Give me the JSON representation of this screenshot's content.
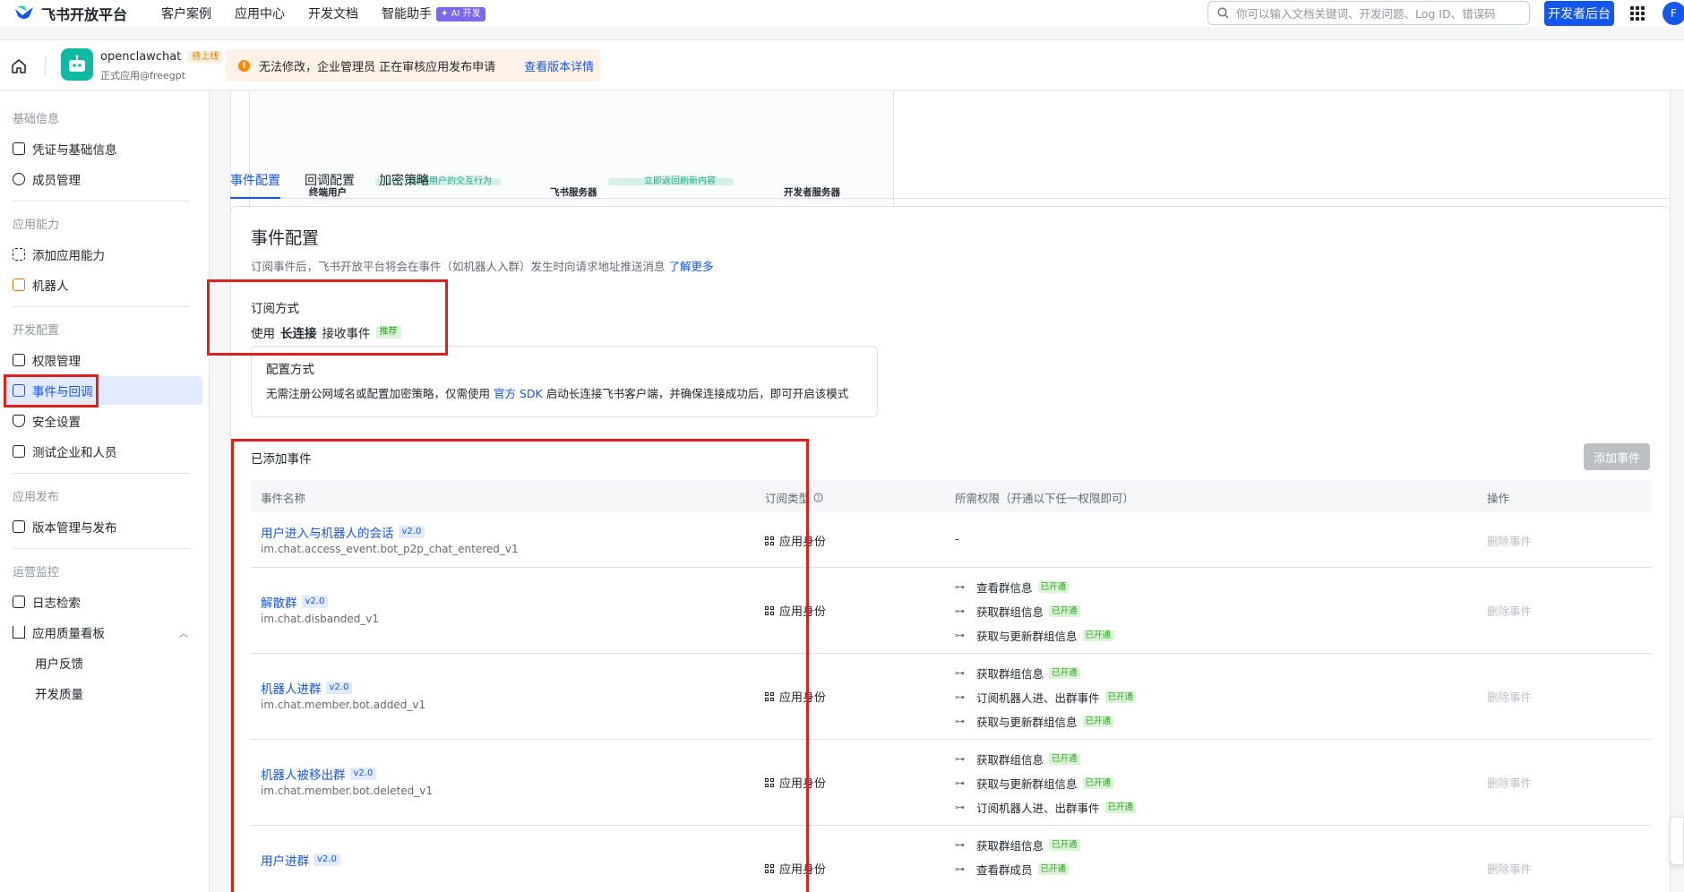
{
  "top_nav": {
    "logo_text": "飞书开放平台",
    "items": [
      "客户案例",
      "应用中心",
      "开发文档",
      "智能助手"
    ],
    "ai_badge": "✦ AI 开发",
    "search_placeholder": "你可以输入文档关键词、开发问题、Log ID、错误码",
    "dev_console": "开发者后台",
    "avatar_letter": "F"
  },
  "app": {
    "name": "openclawchat",
    "status": "待上线",
    "subtitle": "正式应用@freegpt"
  },
  "warning": {
    "text": "无法修改，企业管理员 正在审核应用发布申请",
    "link": "查看版本详情"
  },
  "sidebar": {
    "sections": [
      {
        "title": "基础信息",
        "items": [
          {
            "label": "凭证与基础信息"
          },
          {
            "label": "成员管理"
          }
        ]
      },
      {
        "title": "应用能力",
        "items": [
          {
            "label": "添加应用能力"
          },
          {
            "label": "机器人"
          }
        ]
      },
      {
        "title": "开发配置",
        "items": [
          {
            "label": "权限管理"
          },
          {
            "label": "事件与回调",
            "active": true
          },
          {
            "label": "安全设置"
          },
          {
            "label": "测试企业和人员"
          }
        ]
      },
      {
        "title": "应用发布",
        "items": [
          {
            "label": "版本管理与发布"
          }
        ]
      },
      {
        "title": "运营监控",
        "items": [
          {
            "label": "日志检索"
          },
          {
            "label": "应用质量看板"
          },
          {
            "label": "用户反馈"
          },
          {
            "label": "开发质量"
          }
        ]
      }
    ]
  },
  "flow": {
    "nodes": [
      "终端用户",
      "飞书服务器",
      "开发者服务器"
    ],
    "arrows": [
      "反馈用户的交互行为",
      "立即返回刷新内容"
    ]
  },
  "tabs": [
    "事件配置",
    "回调配置",
    "加密策略"
  ],
  "event_config": {
    "title": "事件配置",
    "desc": "订阅事件后，飞书开放平台将会在事件（如机器人入群）发生时向请求地址推送消息",
    "desc_link": "了解更多",
    "subscribe_title": "订阅方式",
    "subscribe_prefix": "使用",
    "subscribe_method": "长连接",
    "subscribe_suffix": "接收事件",
    "recommend": "推荐",
    "mode_title": "配置方式",
    "mode_desc_1": "无需注册公网域名或配置加密策略，仅需使用",
    "mode_link": "官方 SDK",
    "mode_desc_2": "启动长连接飞书客户端，并确保连接成功后，即可开启该模式"
  },
  "events_table": {
    "title": "已添加事件",
    "add_button": "添加事件",
    "columns": [
      "事件名称",
      "订阅类型",
      "所需权限（开通以下任一权限即可）",
      "操作"
    ],
    "rows": [
      {
        "name": "用户进入与机器人的会话",
        "ver": "v2.0",
        "id": "im.chat.access_event.bot_p2p_chat_entered_v1",
        "type": "应用身份",
        "perms": [],
        "perm_empty": "-",
        "action": "删除事件"
      },
      {
        "name": "解散群",
        "ver": "v2.0",
        "id": "im.chat.disbanded_v1",
        "type": "应用身份",
        "perms": [
          {
            "label": "查看群信息",
            "status": "已开通"
          },
          {
            "label": "获取群组信息",
            "status": "已开通"
          },
          {
            "label": "获取与更新群组信息",
            "status": "已开通"
          }
        ],
        "action": "删除事件"
      },
      {
        "name": "机器人进群",
        "ver": "v2.0",
        "id": "im.chat.member.bot.added_v1",
        "type": "应用身份",
        "perms": [
          {
            "label": "获取群组信息",
            "status": "已开通"
          },
          {
            "label": "订阅机器人进、出群事件",
            "status": "已开通"
          },
          {
            "label": "获取与更新群组信息",
            "status": "已开通"
          }
        ],
        "action": "删除事件"
      },
      {
        "name": "机器人被移出群",
        "ver": "v2.0",
        "id": "im.chat.member.bot.deleted_v1",
        "type": "应用身份",
        "perms": [
          {
            "label": "获取群组信息",
            "status": "已开通"
          },
          {
            "label": "获取与更新群组信息",
            "status": "已开通"
          },
          {
            "label": "订阅机器人进、出群事件",
            "status": "已开通"
          }
        ],
        "action": "删除事件"
      },
      {
        "name": "用户进群",
        "ver": "v2.0",
        "id": "",
        "type": "应用身份",
        "perms": [
          {
            "label": "获取群组信息",
            "status": "已开通"
          },
          {
            "label": "查看群成员",
            "status": "已开通"
          }
        ],
        "action": "删除事件"
      }
    ]
  },
  "colors": {
    "accent": "#1456f0",
    "highlight_box": "#e0211b",
    "app_icon": "#10b9a3"
  }
}
